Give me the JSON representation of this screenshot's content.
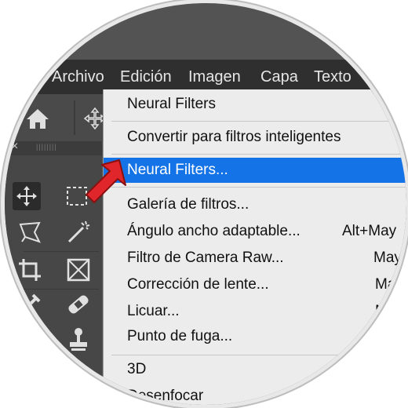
{
  "menubar": {
    "items": [
      "Archivo",
      "Edición",
      "Imagen",
      "Capa",
      "Texto"
    ]
  },
  "panel": {
    "close_glyph": "×",
    "grip": "||||||||"
  },
  "dropdown": {
    "last_filter": "Neural Filters",
    "convert": "Convertir para filtros inteligentes",
    "highlighted": "Neural Filters...",
    "items": [
      {
        "label": "Galería de filtros...",
        "shortcut": ""
      },
      {
        "label": "Ángulo ancho adaptable...",
        "shortcut": "Alt+May"
      },
      {
        "label": "Filtro de Camera Raw...",
        "shortcut": "May"
      },
      {
        "label": "Corrección de lente...",
        "shortcut": "Ma"
      },
      {
        "label": "Licuar...",
        "shortcut": "M"
      },
      {
        "label": "Punto de fuga...",
        "shortcut": ""
      }
    ],
    "submenus": [
      "3D",
      "Desenfocar"
    ]
  },
  "icons": [
    "home-icon",
    "move-icon",
    "marquee-icon",
    "lasso-icon",
    "magic-wand-icon",
    "crop-icon",
    "frame-icon",
    "healing-icon",
    "stamp-icon",
    "pointer-arrow-icon"
  ],
  "colors": {
    "highlight": "#1473e6",
    "menubar": "#2f2f2f",
    "menu_bg": "#ececec",
    "arrow": "#e0262b"
  }
}
